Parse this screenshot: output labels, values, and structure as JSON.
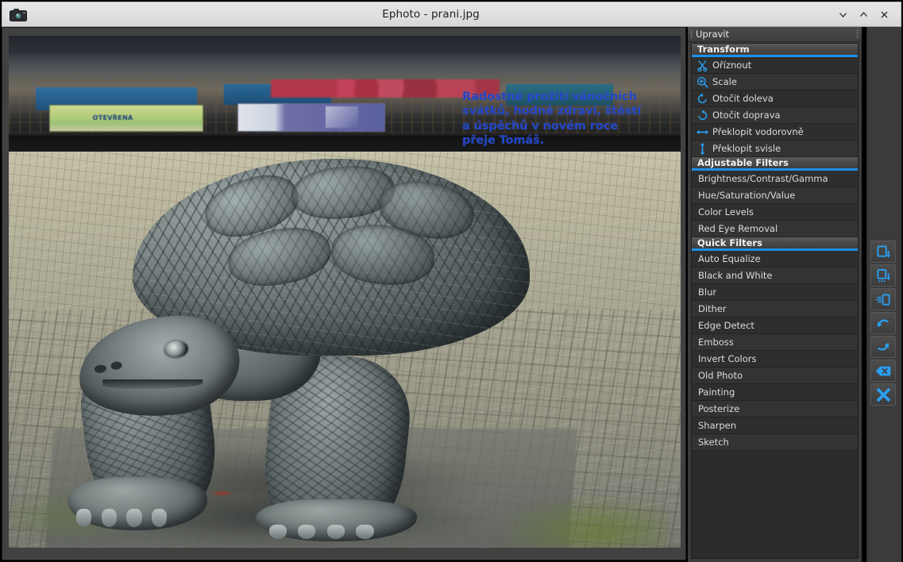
{
  "window": {
    "title": "Ephoto - prani.jpg",
    "app_icon": "camera-icon",
    "controls": {
      "minimize": "minimize-chevron-down-icon",
      "maximize": "maximize-chevron-up-icon",
      "close": "close-x-icon"
    }
  },
  "canvas": {
    "image_name": "prani.jpg",
    "overlay_text": "Radostné prožití vánočních svátků, hodně zdraví, štěstí a úspěchů v novém roce přeje Tomáš.",
    "overlay_lines": [
      "Radostné prožití vánočních",
      "svátků, hodně zdraví, štěstí",
      "a úspěchů v novém roce",
      "přeje Tomáš."
    ],
    "overlay_color": "#1f44c8",
    "banner_green_text": "OTEVŘENA"
  },
  "dock": {
    "title": "Upravit",
    "accent_color": "#1e90e8",
    "sections": [
      {
        "heading": "Transform",
        "items": [
          {
            "label": "Oříznout",
            "icon": "scissors-icon"
          },
          {
            "label": "Scale",
            "icon": "zoom-in-icon"
          },
          {
            "label": "Otočit doleva",
            "icon": "rotate-left-icon"
          },
          {
            "label": "Otočit doprava",
            "icon": "rotate-right-icon"
          },
          {
            "label": "Překlopit vodorovně",
            "icon": "flip-horizontal-icon"
          },
          {
            "label": "Překlopit svisle",
            "icon": "flip-vertical-icon"
          }
        ]
      },
      {
        "heading": "Adjustable Filters",
        "items": [
          {
            "label": "Brightness/Contrast/Gamma",
            "icon": ""
          },
          {
            "label": "Hue/Saturation/Value",
            "icon": ""
          },
          {
            "label": "Color Levels",
            "icon": ""
          },
          {
            "label": "Red Eye Removal",
            "icon": ""
          }
        ]
      },
      {
        "heading": "Quick Filters",
        "items": [
          {
            "label": "Auto Equalize",
            "icon": ""
          },
          {
            "label": "Black and White",
            "icon": ""
          },
          {
            "label": "Blur",
            "icon": ""
          },
          {
            "label": "Dither",
            "icon": ""
          },
          {
            "label": "Edge Detect",
            "icon": ""
          },
          {
            "label": "Emboss",
            "icon": ""
          },
          {
            "label": "Invert Colors",
            "icon": ""
          },
          {
            "label": "Old Photo",
            "icon": ""
          },
          {
            "label": "Painting",
            "icon": ""
          },
          {
            "label": "Posterize",
            "icon": ""
          },
          {
            "label": "Sharpen",
            "icon": ""
          },
          {
            "label": "Sketch",
            "icon": ""
          }
        ]
      }
    ]
  },
  "toolbar": {
    "buttons": [
      {
        "name": "save-icon",
        "title": "Save"
      },
      {
        "name": "save-as-icon",
        "title": "Save As"
      },
      {
        "name": "export-icon",
        "title": "Export"
      },
      {
        "name": "undo-icon",
        "title": "Undo"
      },
      {
        "name": "redo-icon",
        "title": "Redo"
      },
      {
        "name": "reset-icon",
        "title": "Reset"
      },
      {
        "name": "close-image-icon",
        "title": "Close"
      }
    ]
  }
}
